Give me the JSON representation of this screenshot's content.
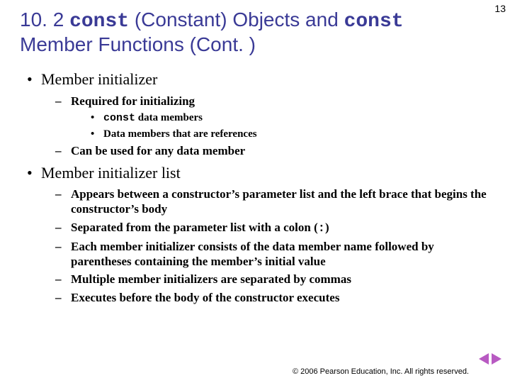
{
  "pageNumber": "13",
  "title": {
    "prefix": "10. 2 ",
    "kw1": "const",
    "mid": " (Constant) Objects and ",
    "kw2": "const",
    "rest": " Member Functions (Cont. )"
  },
  "bullets": {
    "b1": "Member initializer",
    "b1_1": "Required for initializing",
    "b1_1_1_kw": "const",
    "b1_1_1_rest": " data members",
    "b1_1_2": "Data members that are references",
    "b1_2": "Can be used for any data member",
    "b2": "Member initializer list",
    "b2_1": "Appears between a constructor’s parameter list and the left brace that begins the constructor’s body",
    "b2_2_pre": "Separated from the parameter list with a colon (",
    "b2_2_kw": ":",
    "b2_2_post": ")",
    "b2_3": "Each member initializer consists of the data member name followed by parentheses containing the member’s initial value",
    "b2_4": "Multiple member initializers are separated by commas",
    "b2_5": "Executes before the body of the constructor executes"
  },
  "footer": "© 2006 Pearson Education, Inc.  All rights reserved."
}
